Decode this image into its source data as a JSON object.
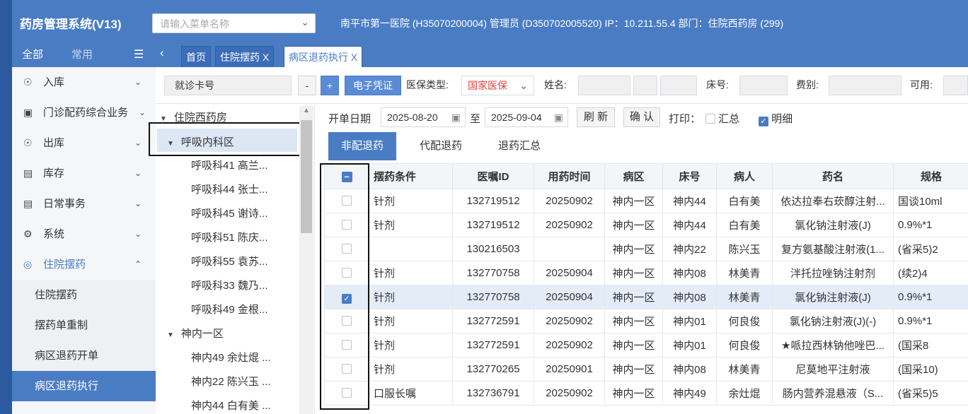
{
  "header": {
    "app_title": "药房管理系统(V13)",
    "menu_search_placeholder": "请输入菜单名称",
    "info": "南平市第一医院 (H35070200004) 管理员 (D350702005520) IP：10.211.55.4 部门：住院西药房 (299)"
  },
  "sidebar": {
    "tab_all": "全部",
    "tab_common": "常用",
    "items": [
      {
        "label": "入库",
        "icon": "inbox-icon"
      },
      {
        "label": "门诊配药综合业务",
        "icon": "lock-icon"
      },
      {
        "label": "出库",
        "icon": "outbox-icon"
      },
      {
        "label": "库存",
        "icon": "wallet-icon"
      },
      {
        "label": "日常事务",
        "icon": "document-icon"
      },
      {
        "label": "系统",
        "icon": "gear-icon"
      },
      {
        "label": "住院摆药",
        "icon": "target-icon"
      }
    ],
    "sub_items": [
      "住院摆药",
      "摆药单重制",
      "病区退药开单",
      "病区退药执行"
    ]
  },
  "tabs": [
    {
      "label": "首页"
    },
    {
      "label": "住院摆药 X"
    },
    {
      "label": "病区退药执行 X"
    }
  ],
  "toolbar": {
    "card_label": "就诊卡号",
    "minus": "-",
    "plus": "+",
    "e_voucher": "电子凭证",
    "insurance_type_label": "医保类型:",
    "insurance_type_value": "国家医保",
    "name_label": "姓名:",
    "bed_label": "床号:",
    "fee_label": "费别:",
    "available_label": "可用:"
  },
  "tree": {
    "root": "住院西药房",
    "groups": [
      {
        "name": "呼吸内科区",
        "children": [
          "呼吸科41 高兰...",
          "呼吸科44 张士...",
          "呼吸科45 谢诗...",
          "呼吸科51 陈庆...",
          "呼吸科55 袁苏...",
          "呼吸科33 魏乃...",
          "呼吸科49 金根..."
        ]
      },
      {
        "name": "神内一区",
        "children": [
          "神内49 余灶焜 ...",
          "神内22 陈兴玉 ...",
          "神内44 白有美 ..."
        ]
      }
    ]
  },
  "filter": {
    "date_label": "开单日期",
    "date_from": "2025-08-20",
    "to_label": "至",
    "date_to": "2025-09-04",
    "refresh": "刷 新",
    "confirm": "确 认",
    "print_label": "打印：",
    "summary_label": "汇总",
    "detail_label": "明细"
  },
  "subtabs": [
    "非配退药",
    "代配退药",
    "退药汇总"
  ],
  "table": {
    "columns": [
      "摆药条件",
      "医嘱ID",
      "用药时间",
      "病区",
      "床号",
      "病人",
      "药名",
      "规格"
    ],
    "rows": [
      {
        "cond": "针剂",
        "id": "132719512",
        "time": "20250902",
        "ward": "神内一区",
        "bed": "神内44",
        "patient": "白有美",
        "drug": "依达拉奉右莰醇注射...",
        "spec": "国谈10ml",
        "checked": false
      },
      {
        "cond": "针剂",
        "id": "132719512",
        "time": "20250902",
        "ward": "神内一区",
        "bed": "神内44",
        "patient": "白有美",
        "drug": "氯化钠注射液(J)",
        "spec": "0.9%*1",
        "checked": false
      },
      {
        "cond": "",
        "id": "130216503",
        "time": "",
        "ward": "神内一区",
        "bed": "神内22",
        "patient": "陈兴玉",
        "drug": "复方氨基酸注射液(1...",
        "spec": "(省采5)2",
        "checked": false
      },
      {
        "cond": "针剂",
        "id": "132770758",
        "time": "20250904",
        "ward": "神内一区",
        "bed": "神内08",
        "patient": "林美青",
        "drug": "泮托拉唑钠注射剂",
        "spec": "(续2)4",
        "checked": false
      },
      {
        "cond": "针剂",
        "id": "132770758",
        "time": "20250904",
        "ward": "神内一区",
        "bed": "神内08",
        "patient": "林美青",
        "drug": "氯化钠注射液(J)",
        "spec": "0.9%*1",
        "checked": true
      },
      {
        "cond": "针剂",
        "id": "132772591",
        "time": "20250902",
        "ward": "神内一区",
        "bed": "神内01",
        "patient": "何良俊",
        "drug": "氯化钠注射液(J)(-)",
        "spec": "0.9%*1",
        "checked": false
      },
      {
        "cond": "针剂",
        "id": "132772591",
        "time": "20250902",
        "ward": "神内一区",
        "bed": "神内01",
        "patient": "何良俊",
        "drug": "★哌拉西林钠他唑巴...",
        "spec": "(国采8",
        "checked": false
      },
      {
        "cond": "针剂",
        "id": "132770265",
        "time": "20250901",
        "ward": "神内一区",
        "bed": "神内08",
        "patient": "林美青",
        "drug": "尼莫地平注射液",
        "spec": "(国采10)",
        "checked": false
      },
      {
        "cond": "口服长嘱",
        "id": "132736791",
        "time": "20250902",
        "ward": "神内一区",
        "bed": "神内49",
        "patient": "余灶焜",
        "drug": "肠内营养混悬液（S...",
        "spec": "(省采5)5",
        "checked": false
      }
    ]
  },
  "colors": {
    "primary": "#4a7cc4",
    "insurance_red": "#e04040"
  }
}
